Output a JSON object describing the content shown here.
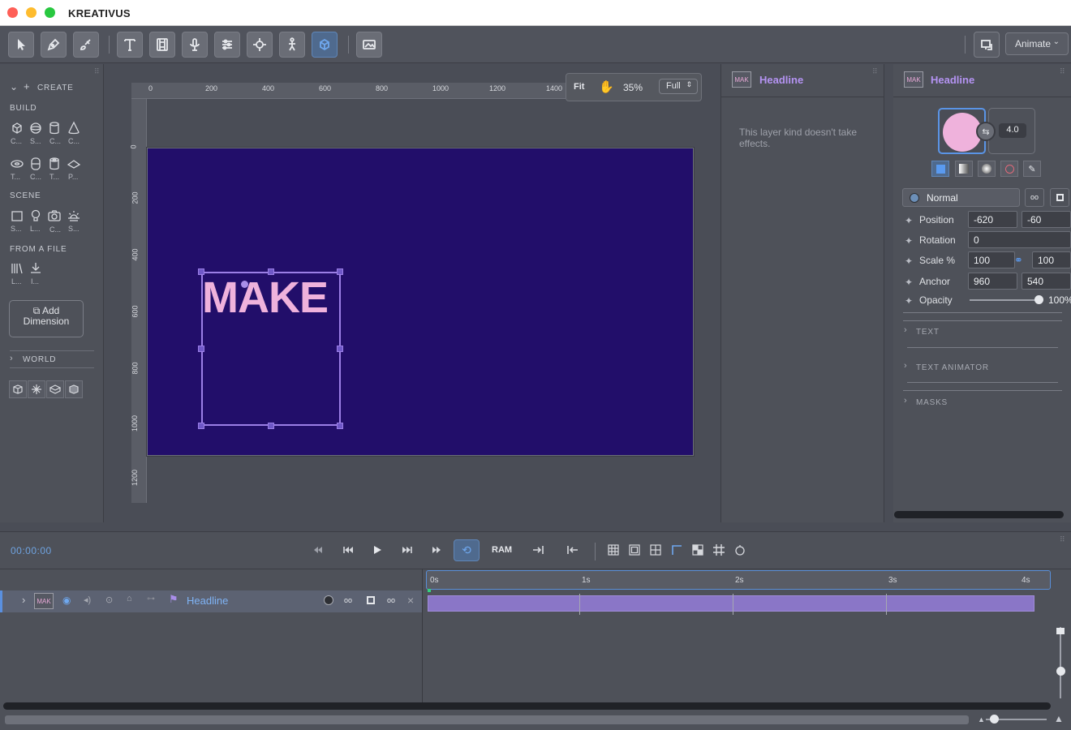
{
  "app": {
    "title": "KREATIVUS"
  },
  "toolbar": {
    "tools": [
      "select-tool",
      "pen-tool",
      "brush-tool",
      "text-tool",
      "film-tool",
      "mic-tool",
      "sliders-tool",
      "target-tool",
      "puppet-tool",
      "cube-tool",
      "image-tool"
    ],
    "mode": "Animate"
  },
  "left_panel": {
    "create_label": "CREATE",
    "build_label": "BUILD",
    "build_items": [
      "C...",
      "S...",
      "C...",
      "C...",
      "T...",
      "C...",
      "T...",
      "P..."
    ],
    "scene_label": "SCENE",
    "scene_items": [
      "S...",
      "L...",
      "C...",
      "S..."
    ],
    "file_label": "FROM A FILE",
    "file_items": [
      "L...",
      "I..."
    ],
    "add_dimension": "Add Dimension",
    "world_label": "WORLD"
  },
  "canvas": {
    "fit_label": "Fit",
    "zoom": "35%",
    "resolution": "Full",
    "ruler_top": [
      "0",
      "200",
      "400",
      "600",
      "800",
      "1000",
      "1200",
      "1400"
    ],
    "ruler_left": [
      "0",
      "200",
      "400",
      "600",
      "800",
      "1000",
      "1200"
    ],
    "headline_text": "MAKE",
    "stage_color": "#220e6a",
    "text_color": "#efb2dc"
  },
  "effects_panel": {
    "layer_badge": "MAK",
    "layer_title": "Headline",
    "message": "This layer kind doesn't take effects."
  },
  "inspector": {
    "layer_badge": "MAK",
    "layer_title": "Headline",
    "stroke_width": "4.0",
    "blend_mode": "Normal",
    "link_label_1": "oo",
    "props": {
      "position_label": "Position",
      "position_x": "-620",
      "position_y": "-60",
      "rotation_label": "Rotation",
      "rotation": "0",
      "scale_label": "Scale %",
      "scale_x": "100",
      "scale_y": "100",
      "anchor_label": "Anchor",
      "anchor_x": "960",
      "anchor_y": "540",
      "opacity_label": "Opacity",
      "opacity": "100%"
    },
    "sections": [
      "TEXT",
      "TEXT ANIMATOR",
      "MASKS"
    ]
  },
  "timeline": {
    "timecode": "00:00:00",
    "ram_label": "RAM",
    "time_labels": [
      "0s",
      "1s",
      "2s",
      "3s",
      "4s"
    ],
    "layer": {
      "badge": "MAK",
      "name": "Headline",
      "link1": "oo",
      "link2": "oo",
      "close": "×"
    }
  }
}
